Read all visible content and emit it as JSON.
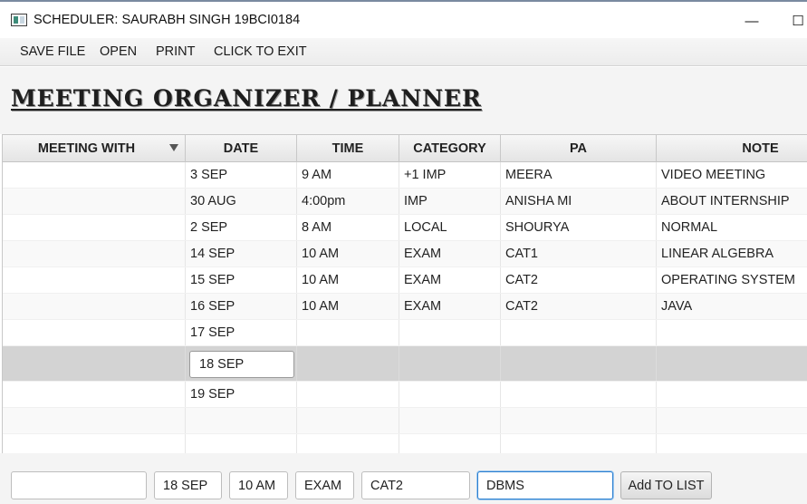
{
  "window": {
    "title": "SCHEDULER: SAURABH SINGH 19BCI0184",
    "app_icon": "app-window-icon",
    "minimize_icon": "minimize-icon",
    "minimize_glyph": "—",
    "maximize_icon": "maximize-icon",
    "maximize_glyph": "☐"
  },
  "menu": {
    "items": [
      {
        "label": "SAVE FILE"
      },
      {
        "label": "OPEN"
      },
      {
        "label": "PRINT"
      },
      {
        "label": "CLICK TO EXIT"
      }
    ]
  },
  "page": {
    "title": "MEETING ORGANIZER / PLANNER"
  },
  "table": {
    "columns": [
      "MEETING WITH",
      "DATE",
      "TIME",
      "CATEGORY",
      "PA",
      "NOTE"
    ],
    "sort_icon": "sort-desc-icon",
    "rows": [
      [
        "",
        "3 SEP",
        "9 AM",
        "+1 IMP",
        "MEERA",
        "VIDEO MEETING"
      ],
      [
        "",
        "30 AUG",
        "4:00pm",
        "IMP",
        "ANISHA MI",
        "ABOUT INTERNSHIP"
      ],
      [
        "",
        "2 SEP",
        "8 AM",
        "LOCAL",
        "SHOURYA",
        "NORMAL"
      ],
      [
        "",
        "14 SEP",
        "10 AM",
        "EXAM",
        "CAT1",
        "LINEAR ALGEBRA"
      ],
      [
        "",
        "15 SEP",
        "10 AM",
        "EXAM",
        "CAT2",
        "OPERATING SYSTEM"
      ],
      [
        "",
        "16 SEP",
        "10 AM",
        "EXAM",
        "CAT2",
        "JAVA"
      ],
      [
        "",
        "17 SEP",
        "",
        "",
        "",
        ""
      ],
      [
        "",
        "",
        "",
        "",
        "",
        ""
      ],
      [
        "",
        "19 SEP",
        "",
        "",
        "",
        ""
      ],
      [
        "",
        "",
        "",
        "",
        "",
        ""
      ],
      [
        "",
        "",
        "",
        "",
        "",
        ""
      ]
    ],
    "editing_value": "18 SEP"
  },
  "form": {
    "meeting_with": "",
    "date": "18 SEP",
    "time": "10 AM",
    "category": "EXAM",
    "pa": "CAT2",
    "note": "DBMS",
    "add_button": "Add TO LIST"
  },
  "colors": {
    "selected_row": "#d3d3d3",
    "focus_border": "#2c7fd0"
  }
}
